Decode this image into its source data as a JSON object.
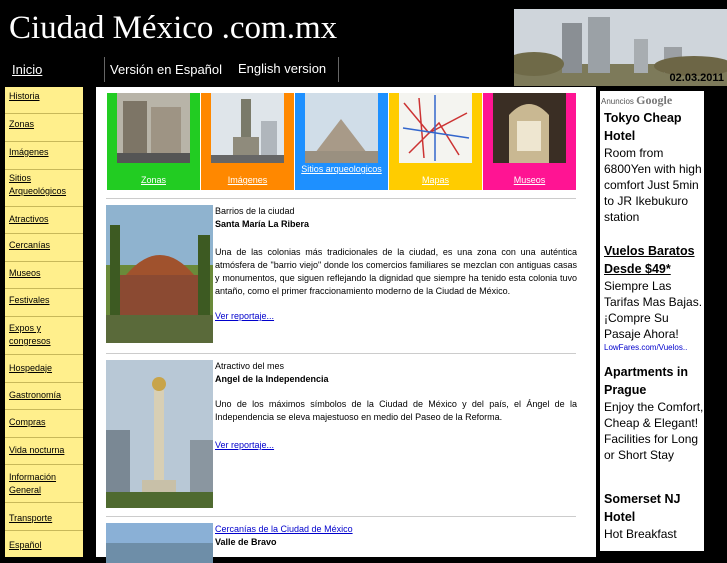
{
  "header": {
    "site_title": "Ciudad México .com.mx",
    "home_link": "Inicio",
    "lang_es": "Versión en Español",
    "lang_en": "English version",
    "date": "02.03.2011"
  },
  "sidebar": {
    "items": [
      {
        "label": "Historia"
      },
      {
        "label": "Zonas"
      },
      {
        "label": "Imágenes"
      },
      {
        "label": "Sitios Arqueológicos"
      },
      {
        "label": "Atractivos"
      },
      {
        "label": "Cercanías"
      },
      {
        "label": "Museos"
      },
      {
        "label": "Festivales"
      },
      {
        "label": "Expos y congresos"
      },
      {
        "label": "Hospedaje"
      },
      {
        "label": "Gastronomía"
      },
      {
        "label": "Compras"
      },
      {
        "label": "Vida nocturna"
      },
      {
        "label": "Información General"
      },
      {
        "label": "Transporte"
      },
      {
        "label": "Español"
      }
    ]
  },
  "tiles": [
    {
      "label": "Zonas",
      "color": "#22cc22"
    },
    {
      "label": "Imágenes",
      "color": "#ff8800"
    },
    {
      "label": "Sitios arqueologicos",
      "color": "#1e90ff"
    },
    {
      "label": "Mapas",
      "color": "#ffcc00"
    },
    {
      "label": "Museos",
      "color": "#ff1493"
    }
  ],
  "articles": [
    {
      "kicker": "Barrios de la ciudad",
      "title": "Santa María La Ribera",
      "body": "Una de las colonias más tradicionales de la ciudad, es una zona con una auténtica atmósfera de \"barrio viejo\" donde los comercios familiares se mezclan con antiguas casas y monumentos, que siguen reflejando la dignidad que siempre ha tenido esta colonia tuvo antaño, como el primer fraccionamiento moderno de la Ciudad de México.",
      "more": "Ver reportaje..."
    },
    {
      "kicker": "Atractivo del mes",
      "title": "Angel de la Independencia",
      "body": "Uno de los máximos símbolos de la Ciudad de México y del país, el Ángel de la Independencia se eleva majestuoso en medio del Paseo de la Reforma.",
      "more": "Ver reportaje..."
    },
    {
      "kicker": "Cercanías de la Ciudad de México",
      "title": "Valle de Bravo"
    }
  ],
  "ads": {
    "header": "Anuncios",
    "google": "Google",
    "items": [
      {
        "title": "Tokyo Cheap Hotel",
        "body": "Room from 6800Yen with high comfort Just 5min to JR Ikebukuro station",
        "url": ""
      },
      {
        "title": "Vuelos Baratos Desde $49*",
        "body": "Siempre Las Tarifas Mas Bajas. ¡Compre Su Pasaje Ahora!",
        "url": "LowFares.com/Vuelos.."
      },
      {
        "title": "Apartments in Prague",
        "body": "Enjoy the Comfort, Cheap & Elegant! Facilities for Long or Short Stay",
        "url": ""
      },
      {
        "title": "Somerset NJ Hotel",
        "body": "Hot Breakfast",
        "url": ""
      }
    ]
  }
}
